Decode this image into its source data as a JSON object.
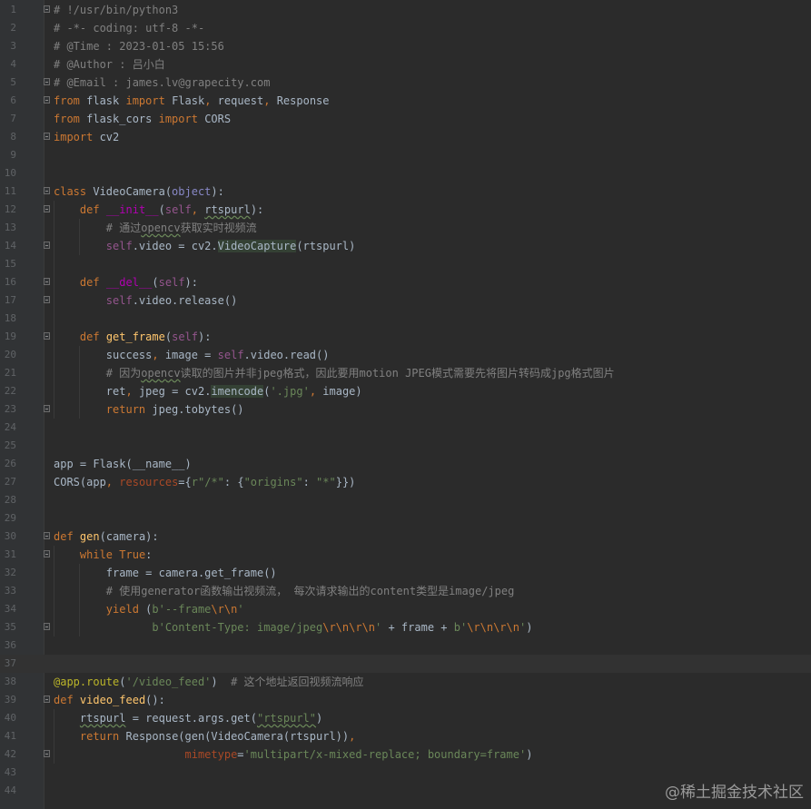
{
  "watermark": "@稀土掘金技术社区",
  "lines": [
    {
      "n": "1",
      "fold": "open",
      "tokens": [
        [
          "cm",
          "# !/usr/bin/python3"
        ]
      ]
    },
    {
      "n": "2",
      "tokens": [
        [
          "cm",
          "# -*- coding: utf-8 -*-"
        ]
      ]
    },
    {
      "n": "3",
      "tokens": [
        [
          "cm",
          "# @Time : 2023-01-05 15:56"
        ]
      ]
    },
    {
      "n": "4",
      "tokens": [
        [
          "cm",
          "# @Author : 吕小白"
        ]
      ]
    },
    {
      "n": "5",
      "fold": "end",
      "tokens": [
        [
          "cm",
          "# @Email : james.lv@grapecity.com"
        ]
      ]
    },
    {
      "n": "6",
      "fold": "open",
      "tokens": [
        [
          "kw",
          "from"
        ],
        [
          "",
          " flask "
        ],
        [
          "kw",
          "import"
        ],
        [
          "",
          " Flask"
        ],
        [
          "kw",
          ","
        ],
        [
          "",
          " request"
        ],
        [
          "kw",
          ","
        ],
        [
          "",
          " Response"
        ]
      ]
    },
    {
      "n": "7",
      "tokens": [
        [
          "kw",
          "from"
        ],
        [
          "",
          " flask_cors "
        ],
        [
          "kw",
          "import"
        ],
        [
          "",
          " CORS"
        ]
      ]
    },
    {
      "n": "8",
      "fold": "end",
      "tokens": [
        [
          "kw",
          "import"
        ],
        [
          "",
          " cv2"
        ]
      ]
    },
    {
      "n": "9",
      "tokens": []
    },
    {
      "n": "10",
      "tokens": []
    },
    {
      "n": "11",
      "fold": "open",
      "tokens": [
        [
          "kw",
          "class"
        ],
        [
          "",
          " VideoCamera("
        ],
        [
          "bi",
          "object"
        ],
        [
          "",
          "):"
        ]
      ]
    },
    {
      "n": "12",
      "fold": "open",
      "tokens": [
        [
          "",
          "    "
        ],
        [
          "kw",
          "def"
        ],
        [
          "",
          " "
        ],
        [
          "dun",
          "__init__"
        ],
        [
          "",
          "("
        ],
        [
          "self",
          "self"
        ],
        [
          "kw",
          ","
        ],
        [
          "",
          " "
        ],
        [
          "typo",
          "rtspurl"
        ],
        [
          "",
          "):"
        ]
      ]
    },
    {
      "n": "13",
      "tokens": [
        [
          "",
          "        "
        ],
        [
          "cm",
          "# 通过"
        ],
        [
          "cm typo",
          "opencv"
        ],
        [
          "cm",
          "获取实时视频流"
        ]
      ]
    },
    {
      "n": "14",
      "fold": "end",
      "tokens": [
        [
          "",
          "        "
        ],
        [
          "self",
          "self"
        ],
        [
          "",
          ".video = cv2."
        ],
        [
          "hl",
          "VideoCapture"
        ],
        [
          "",
          "(rtspurl)"
        ]
      ]
    },
    {
      "n": "15",
      "tokens": []
    },
    {
      "n": "16",
      "fold": "open",
      "tokens": [
        [
          "",
          "    "
        ],
        [
          "kw",
          "def"
        ],
        [
          "",
          " "
        ],
        [
          "dun",
          "__del__"
        ],
        [
          "",
          "("
        ],
        [
          "self",
          "self"
        ],
        [
          "",
          "):"
        ]
      ]
    },
    {
      "n": "17",
      "fold": "end",
      "tokens": [
        [
          "",
          "        "
        ],
        [
          "self",
          "self"
        ],
        [
          "",
          ".video.release()"
        ]
      ]
    },
    {
      "n": "18",
      "tokens": []
    },
    {
      "n": "19",
      "fold": "open",
      "tokens": [
        [
          "",
          "    "
        ],
        [
          "kw",
          "def"
        ],
        [
          "",
          " "
        ],
        [
          "fn",
          "get_frame"
        ],
        [
          "",
          "("
        ],
        [
          "self",
          "self"
        ],
        [
          "",
          "):"
        ]
      ]
    },
    {
      "n": "20",
      "tokens": [
        [
          "",
          "        success"
        ],
        [
          "kw",
          ","
        ],
        [
          "",
          " image = "
        ],
        [
          "self",
          "self"
        ],
        [
          "",
          ".video.read()"
        ]
      ]
    },
    {
      "n": "21",
      "tokens": [
        [
          "",
          "        "
        ],
        [
          "cm",
          "# 因为"
        ],
        [
          "cm typo",
          "opencv"
        ],
        [
          "cm",
          "读取的图片并非jpeg格式，因此要用motion JPEG模式需要先将图片转码成jpg格式图片"
        ]
      ]
    },
    {
      "n": "22",
      "tokens": [
        [
          "",
          "        ret"
        ],
        [
          "kw",
          ","
        ],
        [
          "",
          " jpeg = cv2."
        ],
        [
          "hl",
          "imencode"
        ],
        [
          "",
          "("
        ],
        [
          "str",
          "'.jpg'"
        ],
        [
          "kw",
          ","
        ],
        [
          "",
          " image)"
        ]
      ]
    },
    {
      "n": "23",
      "fold": "end",
      "tokens": [
        [
          "",
          "        "
        ],
        [
          "kw",
          "return"
        ],
        [
          "",
          " jpeg.tobytes()"
        ]
      ]
    },
    {
      "n": "24",
      "tokens": []
    },
    {
      "n": "25",
      "tokens": []
    },
    {
      "n": "26",
      "tokens": [
        [
          "",
          "app = Flask(__name__)"
        ]
      ]
    },
    {
      "n": "27",
      "tokens": [
        [
          "",
          "CORS(app"
        ],
        [
          "kw",
          ","
        ],
        [
          "",
          " "
        ],
        [
          "kwarg",
          "resources"
        ],
        [
          "",
          "={"
        ],
        [
          "str",
          "r\"/*\""
        ],
        [
          "",
          ": {"
        ],
        [
          "str",
          "\"origins\""
        ],
        [
          "",
          ": "
        ],
        [
          "str",
          "\"*\""
        ],
        [
          "",
          "}})"
        ]
      ]
    },
    {
      "n": "28",
      "tokens": []
    },
    {
      "n": "29",
      "tokens": []
    },
    {
      "n": "30",
      "fold": "open",
      "tokens": [
        [
          "kw",
          "def"
        ],
        [
          "",
          " "
        ],
        [
          "fn",
          "gen"
        ],
        [
          "",
          "(camera):"
        ]
      ]
    },
    {
      "n": "31",
      "fold": "open",
      "tokens": [
        [
          "",
          "    "
        ],
        [
          "kw",
          "while"
        ],
        [
          "",
          " "
        ],
        [
          "kw",
          "True"
        ],
        [
          "",
          ":"
        ]
      ]
    },
    {
      "n": "32",
      "tokens": [
        [
          "",
          "        frame = camera.get_frame()"
        ]
      ]
    },
    {
      "n": "33",
      "tokens": [
        [
          "",
          "        "
        ],
        [
          "cm",
          "# 使用generator函数输出视频流， 每次请求输出的content类型是image/jpeg"
        ]
      ]
    },
    {
      "n": "34",
      "tokens": [
        [
          "",
          "        "
        ],
        [
          "kw",
          "yield"
        ],
        [
          "",
          " ("
        ],
        [
          "str",
          "b'--frame"
        ],
        [
          "esc",
          "\\r\\n"
        ],
        [
          "str",
          "'"
        ]
      ]
    },
    {
      "n": "35",
      "fold": "end",
      "tokens": [
        [
          "",
          "               "
        ],
        [
          "str",
          "b'Content-Type: image/jpeg"
        ],
        [
          "esc",
          "\\r\\n\\r\\n"
        ],
        [
          "str",
          "'"
        ],
        [
          "",
          " + frame + "
        ],
        [
          "str",
          "b'"
        ],
        [
          "esc",
          "\\r\\n\\r\\n"
        ],
        [
          "str",
          "'"
        ],
        [
          "",
          ")"
        ]
      ]
    },
    {
      "n": "36",
      "tokens": []
    },
    {
      "n": "37",
      "current": true,
      "tokens": []
    },
    {
      "n": "38",
      "tokens": [
        [
          "dec",
          "@app.route"
        ],
        [
          "",
          "("
        ],
        [
          "str",
          "'/video_feed'"
        ],
        [
          "",
          ")  "
        ],
        [
          "cm",
          "# 这个地址返回视频流响应"
        ]
      ]
    },
    {
      "n": "39",
      "fold": "open",
      "tokens": [
        [
          "kw",
          "def"
        ],
        [
          "",
          " "
        ],
        [
          "fn",
          "video_feed"
        ],
        [
          "",
          "():"
        ]
      ]
    },
    {
      "n": "40",
      "tokens": [
        [
          "",
          "    "
        ],
        [
          "typo",
          "rtspurl"
        ],
        [
          "",
          " = request.args.get("
        ],
        [
          "str typo",
          "\"rtspurl\""
        ],
        [
          "",
          ")"
        ]
      ]
    },
    {
      "n": "41",
      "tokens": [
        [
          "",
          "    "
        ],
        [
          "kw",
          "return"
        ],
        [
          "",
          " Response(gen(VideoCamera(rtspurl))"
        ],
        [
          "kw",
          ","
        ]
      ]
    },
    {
      "n": "42",
      "fold": "end",
      "tokens": [
        [
          "",
          "                    "
        ],
        [
          "kwarg",
          "mimetype"
        ],
        [
          "",
          "="
        ],
        [
          "str",
          "'multipart/x-mixed-replace; boundary=frame'"
        ],
        [
          "",
          ")"
        ]
      ]
    },
    {
      "n": "43",
      "tokens": []
    },
    {
      "n": "44",
      "tokens": []
    }
  ]
}
